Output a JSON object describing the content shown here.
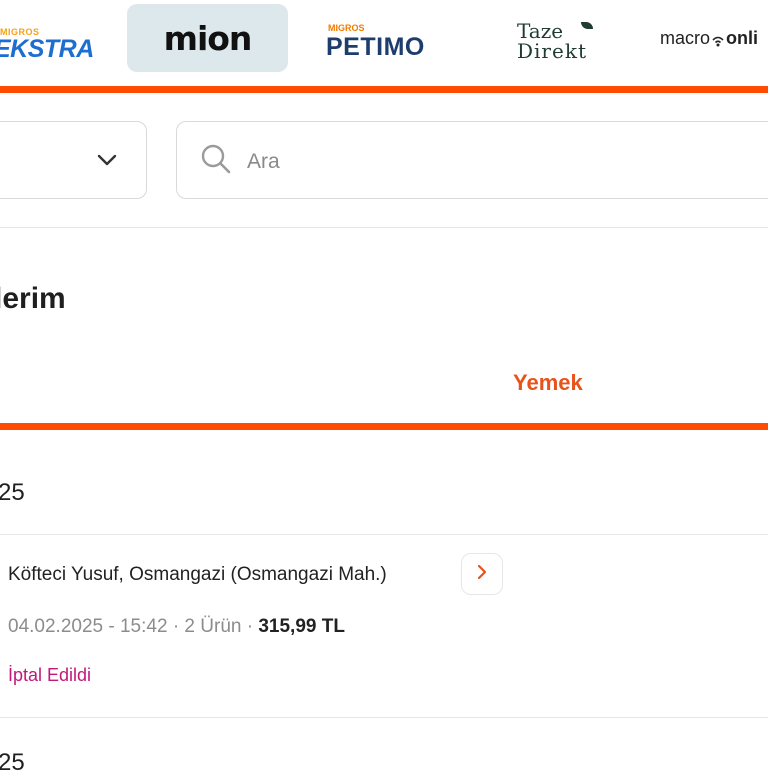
{
  "brands": [
    {
      "name": "Migros Ekstra",
      "super": "MIGROS",
      "main": "EKSTRA",
      "active": false
    },
    {
      "name": "Mion",
      "main": "mion",
      "active": true
    },
    {
      "name": "Migros Petimo",
      "super": "MIGROS",
      "main": "PETIMO",
      "active": false
    },
    {
      "name": "Taze Direkt",
      "line1": "Taze",
      "line2": "Direkt",
      "active": false
    },
    {
      "name": "Macroonline",
      "prefix": "macro",
      "suffix": "onli",
      "active": false
    }
  ],
  "search": {
    "placeholder": "Ara",
    "value": ""
  },
  "selector": {
    "icon": "chevron-down-icon"
  },
  "page": {
    "title": "lerim"
  },
  "tabs": {
    "active_label": "Yemek"
  },
  "orders": {
    "groups": [
      {
        "date_heading": "25",
        "items": [
          {
            "shop": "Köfteci Yusuf, Osmangazi (Osmangazi Mah.)",
            "datetime": "04.02.2025 - 15:42",
            "separator": "·",
            "item_count": "2 Ürün",
            "price": "315,99 TL",
            "status": "İptal Edildi"
          }
        ]
      },
      {
        "date_heading": "25"
      }
    ]
  },
  "colors": {
    "accent": "#ff4c00",
    "tab_active": "#e8531b",
    "status_cancelled": "#c2187a",
    "brand_active_bg": "#dde8ec"
  }
}
